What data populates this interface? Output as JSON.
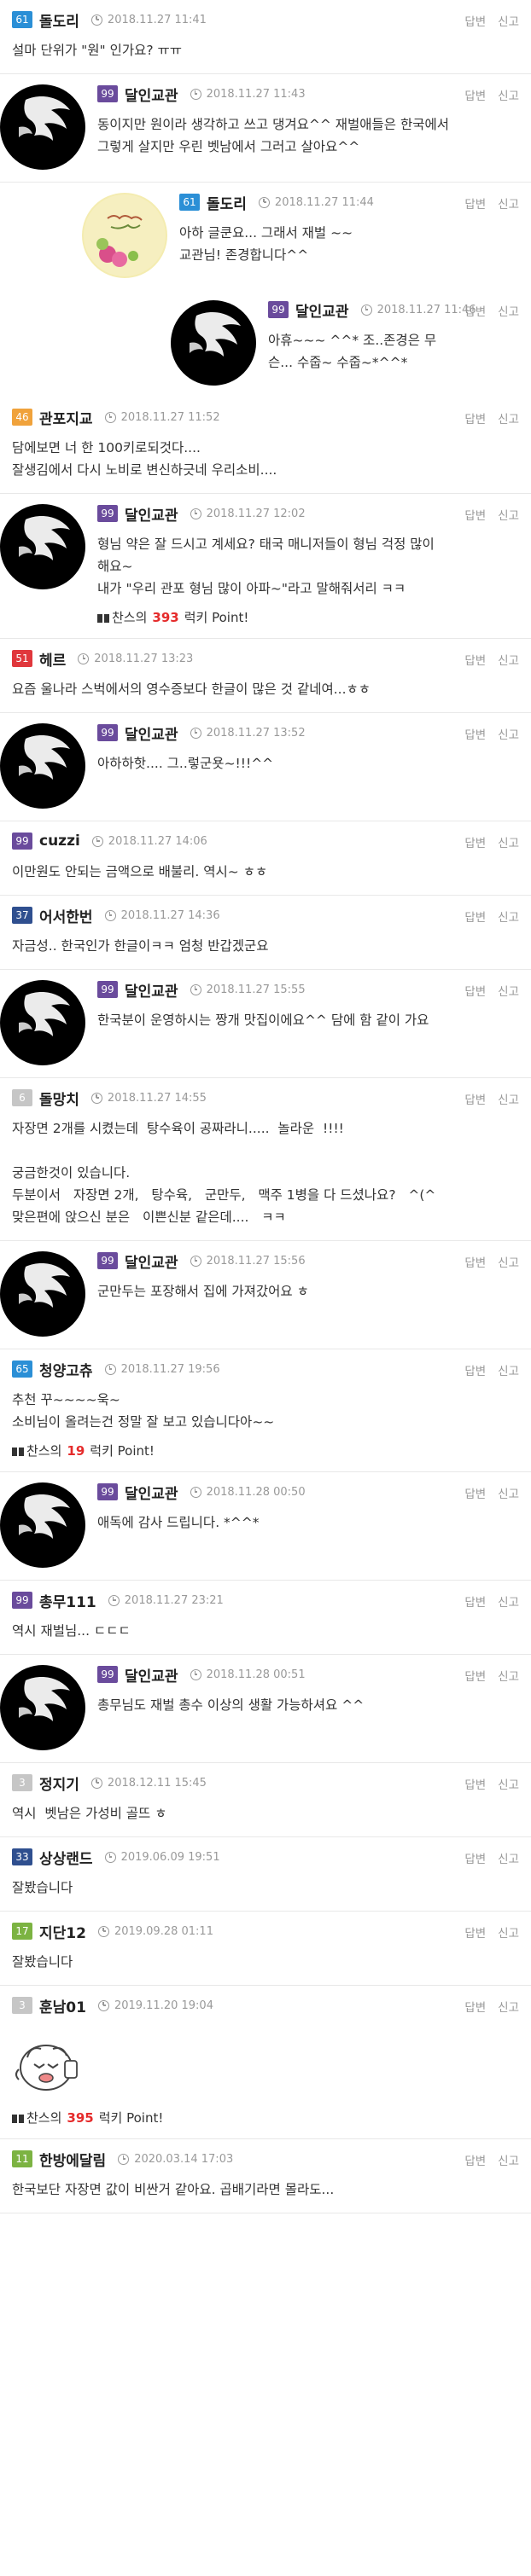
{
  "actions": {
    "reply_label": "답변",
    "report_label": "신고"
  },
  "level_colors": {
    "purple": "#6a4b9c",
    "blue": "#2b8fd6",
    "orange": "#f0a23b",
    "red": "#e0373c",
    "gray": "#c6c6c6",
    "green": "#7cb342",
    "teal": "#27a3a3",
    "navy": "#2f4f8f"
  },
  "lucky_template": {
    "prefix": "찬스의",
    "suffix": "럭키 Point!"
  },
  "comments": [
    {
      "type": "top",
      "level": "61",
      "level_color": "#2b8fd6",
      "nick": "돌도리",
      "date": "2018.11.27 11:41",
      "text": "설마 단위가 \"원\" 인가요? ㅠㅠ"
    },
    {
      "type": "reply",
      "avatar": "black",
      "level": "99",
      "level_color": "#6a4b9c",
      "nick": "달인교관",
      "date": "2018.11.27 11:43",
      "text": "동이지만 원이라 생각하고 쓰고 댕겨요^^ 재벌애들은 한국에서\n그렇게 살지만 우린 벳남에서 그러고 살아요^^"
    },
    {
      "type": "reply2",
      "avatar": "deco",
      "level": "61",
      "level_color": "#2b8fd6",
      "nick": "돌도리",
      "date": "2018.11.27 11:44",
      "text": "아하 글쿤요... 그래서 재벌 ~~\n교관님! 존경합니다^^"
    },
    {
      "type": "reply3",
      "avatar": "black",
      "level": "99",
      "level_color": "#6a4b9c",
      "nick": "달인교관",
      "date": "2018.11.27 11:46",
      "text": "아휴~~~ ^^* 조..존경은 무\n슨... 수줍~ 수줍~*^^*"
    },
    {
      "type": "top",
      "level": "46",
      "level_color": "#f0a23b",
      "nick": "관포지교",
      "date": "2018.11.27 11:52",
      "text": "담에보면 너 한 100키로되것다....\n잘생김에서 다시 노비로 변신하긋네 우리소비...."
    },
    {
      "type": "reply",
      "avatar": "black",
      "level": "99",
      "level_color": "#6a4b9c",
      "nick": "달인교관",
      "date": "2018.11.27 12:02",
      "text": "형님 약은 잘 드시고 계세요? 태국 매니저들이 형님 걱정 많이\n해요~\n내가 \"우리 관포 형님 많이 아파~\"라고 말해줘서리 ㅋㅋ",
      "lucky": "393"
    },
    {
      "type": "top",
      "level": "51",
      "level_color": "#e0373c",
      "nick": "헤르",
      "date": "2018.11.27 13:23",
      "text": "요즘 울나라 스벅에서의 영수증보다 한글이 많은 것 같네여...ㅎㅎ"
    },
    {
      "type": "reply",
      "avatar": "black",
      "level": "99",
      "level_color": "#6a4b9c",
      "nick": "달인교관",
      "date": "2018.11.27 13:52",
      "text": "아하하핫.... 그..렇군욧~!!!^^"
    },
    {
      "type": "top",
      "level": "99",
      "level_color": "#6a4b9c",
      "nick": "cuzzi",
      "date": "2018.11.27 14:06",
      "text": "이만원도 안되는 금액으로 배불리. 역시~ ㅎㅎ"
    },
    {
      "type": "top",
      "level": "37",
      "level_color": "#2f4f8f",
      "nick": "어서한번",
      "date": "2018.11.27 14:36",
      "text": "자금성.. 한국인가 한글이ㅋㅋ 엄청 반갑겠군요"
    },
    {
      "type": "reply",
      "avatar": "black",
      "level": "99",
      "level_color": "#6a4b9c",
      "nick": "달인교관",
      "date": "2018.11.27 15:55",
      "text": "한국분이 운영하시는 짱개 맛집이에요^^ 담에 함 같이 가요"
    },
    {
      "type": "top",
      "level": "6",
      "level_color": "#c6c6c6",
      "nick": "돌망치",
      "date": "2018.11.27 14:55",
      "text": "자장면 2개를 시켰는데  탕수육이 공짜라니.....  놀라운  !!!!\n\n궁금한것이 있습니다.\n두분이서   자장면 2개,   탕수육,   군만두,   맥주 1병을 다 드셨나요?   ^(^\n맞은편에 앉으신 분은   이쁜신분 같은데....   ㅋㅋ"
    },
    {
      "type": "reply",
      "avatar": "black",
      "level": "99",
      "level_color": "#6a4b9c",
      "nick": "달인교관",
      "date": "2018.11.27 15:56",
      "text": "군만두는 포장해서 집에 가져갔어요 ㅎ"
    },
    {
      "type": "top",
      "level": "65",
      "level_color": "#2b8fd6",
      "nick": "청양고츄",
      "date": "2018.11.27 19:56",
      "text": "추천 꾸~~~~욱~\n소비님이 올려는건 정말 잘 보고 있습니다아~~",
      "lucky": "19"
    },
    {
      "type": "reply",
      "avatar": "black",
      "level": "99",
      "level_color": "#6a4b9c",
      "nick": "달인교관",
      "date": "2018.11.28 00:50",
      "text": "애독에 감사 드립니다. *^^*"
    },
    {
      "type": "top",
      "level": "99",
      "level_color": "#6a4b9c",
      "nick": "총무111",
      "date": "2018.11.27 23:21",
      "text": "역시 재벌님... ㄷㄷㄷ"
    },
    {
      "type": "reply",
      "avatar": "black",
      "level": "99",
      "level_color": "#6a4b9c",
      "nick": "달인교관",
      "date": "2018.11.28 00:51",
      "text": "총무님도 재벌 총수 이상의 생활 가능하셔요 ^^"
    },
    {
      "type": "top",
      "level": "3",
      "level_color": "#c6c6c6",
      "nick": "정지기",
      "date": "2018.12.11 15:45",
      "text": "역시  벳남은 가성비 골뜨 ㅎ"
    },
    {
      "type": "top",
      "level": "33",
      "level_color": "#2f4f8f",
      "nick": "상상랜드",
      "date": "2019.06.09 19:51",
      "text": "잘봤습니다"
    },
    {
      "type": "top",
      "level": "17",
      "level_color": "#7cb342",
      "nick": "지단12",
      "date": "2019.09.28 01:11",
      "text": "잘봤습니다"
    },
    {
      "type": "top",
      "level": "3",
      "level_color": "#c6c6c6",
      "nick": "훈남01",
      "date": "2019.11.20 19:04",
      "text": "",
      "emoticon": true,
      "lucky": "395"
    },
    {
      "type": "top",
      "level": "11",
      "level_color": "#7cb342",
      "nick": "한방에달림",
      "date": "2020.03.14 17:03",
      "text": "한국보단 자장면 값이 비싼거 같아요. 곱배기라면 몰라도..."
    }
  ]
}
